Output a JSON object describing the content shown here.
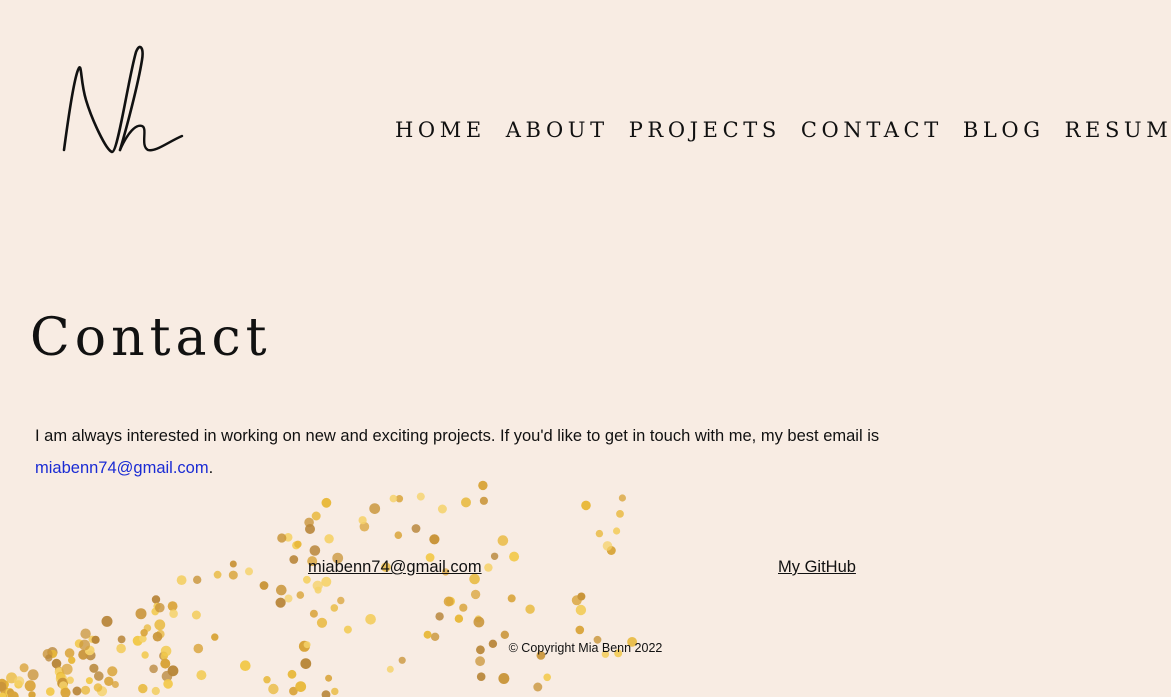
{
  "logo": {
    "icon": "mh-signature-logo"
  },
  "nav": {
    "items": [
      "HOME",
      "ABOUT",
      "PROJECTS",
      "CONTACT",
      "BLOG",
      "RESUME"
    ]
  },
  "main": {
    "title": "Contact",
    "intro_text": "I am always interested in working on new and exciting projects. If you'd like to get in touch with me, my best email is ",
    "intro_email": "miabenn74@gmail.com",
    "intro_period": "."
  },
  "footer": {
    "email_label": "miabenn74@gmail.com",
    "github_label": "My GitHub",
    "copyright": "© Copyright Mia Benn 2022"
  },
  "colors": {
    "background": "#f8ece3",
    "link": "#1a2bd4",
    "confetti_gold": "#e8b83a"
  }
}
